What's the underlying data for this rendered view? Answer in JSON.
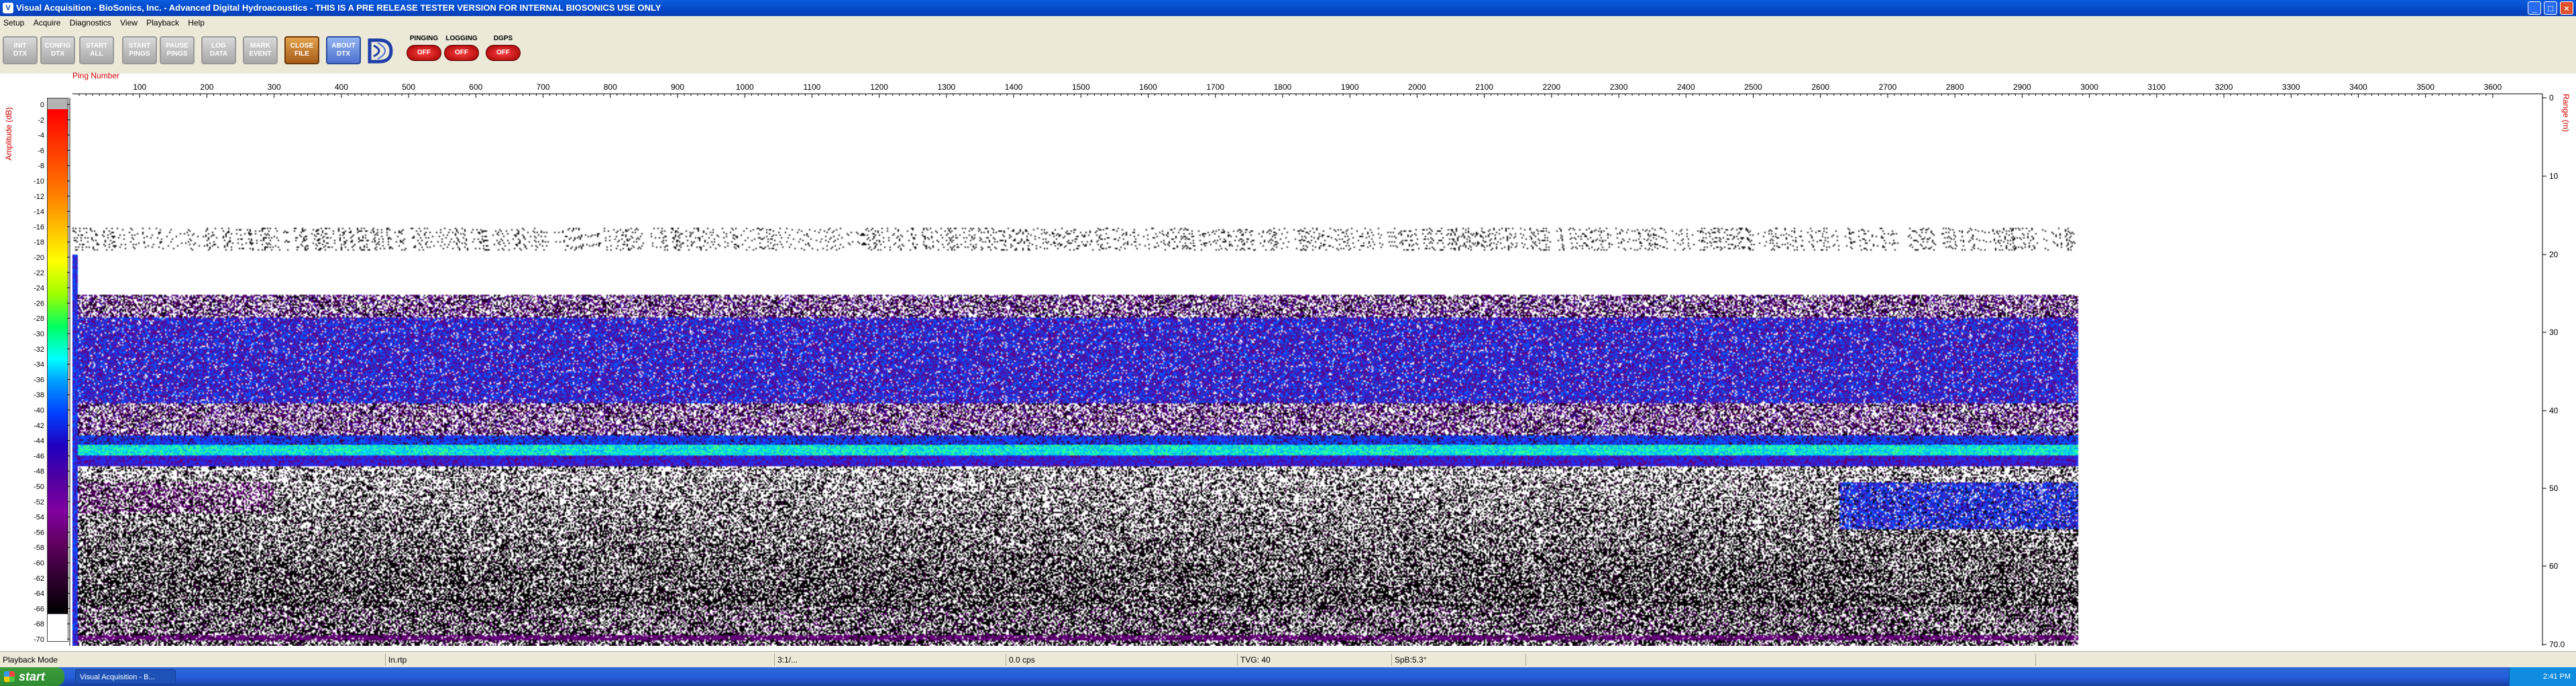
{
  "window": {
    "title": "Visual Acquisition  -  BioSonics, Inc.  -  Advanced Digital Hydroacoustics  -  THIS IS A PRE RELEASE TESTER VERSION FOR INTERNAL BIOSONICS USE ONLY",
    "controls": [
      "_",
      "□",
      "×"
    ]
  },
  "menu": [
    "Setup",
    "Acquire",
    "Diagnostics",
    "View",
    "Playback",
    "Help"
  ],
  "toolbar": {
    "buttons": [
      {
        "label": "INIT\nDTX",
        "style": "gray"
      },
      {
        "label": "CONFIG\nDTX",
        "style": "gray"
      },
      {
        "label": "START\nALL",
        "style": "gray"
      },
      {
        "label": "START\nPINGS",
        "style": "gray"
      },
      {
        "label": "PAUSE\nPINGS",
        "style": "gray"
      },
      {
        "label": "LOG\nDATA",
        "style": "gray"
      },
      {
        "label": "MARK\nEVENT",
        "style": "gray"
      },
      {
        "label": "CLOSE\nFILE",
        "style": "orange"
      },
      {
        "label": "ABOUT\nDTX",
        "style": "blue"
      }
    ],
    "status": [
      {
        "title": "PINGING",
        "state": "OFF"
      },
      {
        "title": "LOGGING",
        "state": "OFF"
      },
      {
        "title": "DGPS",
        "state": "OFF"
      }
    ]
  },
  "echogram": {
    "ping_label": "Ping Number",
    "amplitude_label": "Amplitude (dB)",
    "range_label": "Range (m)",
    "x_ticks": [
      100,
      200,
      300,
      400,
      500,
      600,
      700,
      800,
      900,
      1000,
      1100,
      1200,
      1300,
      1400,
      1500,
      1600,
      1700,
      1800,
      1900,
      2000,
      2100,
      2200,
      2300,
      2400,
      2500,
      2600,
      2700,
      2800,
      2900,
      3000,
      3100,
      3200,
      3300,
      3400,
      3500,
      3600
    ],
    "amp_ticks": [
      0,
      -2,
      -4,
      -6,
      -8,
      -10,
      -12,
      -14,
      -16,
      -18,
      -20,
      -22,
      -24,
      -26,
      -28,
      -30,
      -32,
      -34,
      -36,
      -38,
      -40,
      -42,
      -44,
      -46,
      -48,
      -50,
      -52,
      -54,
      -56,
      -58,
      -60,
      -62,
      -64,
      -66,
      -68,
      -70
    ],
    "range_ticks": [
      "0",
      "10",
      "20",
      "30",
      "40",
      "50",
      "60",
      "70.0"
    ],
    "bottom_depth_m": 44.5,
    "last_ping": 2985
  },
  "statusbar": {
    "mode": "Playback Mode",
    "field2": "In.rtp",
    "field3": "3:1/...",
    "field4": "0.0 cps",
    "field5": "TVG: 40",
    "field6": "SpB:5.3°"
  },
  "taskbar": {
    "start": "start",
    "task": "Visual Acquisition  -  B...",
    "clock": "2:41 PM"
  }
}
